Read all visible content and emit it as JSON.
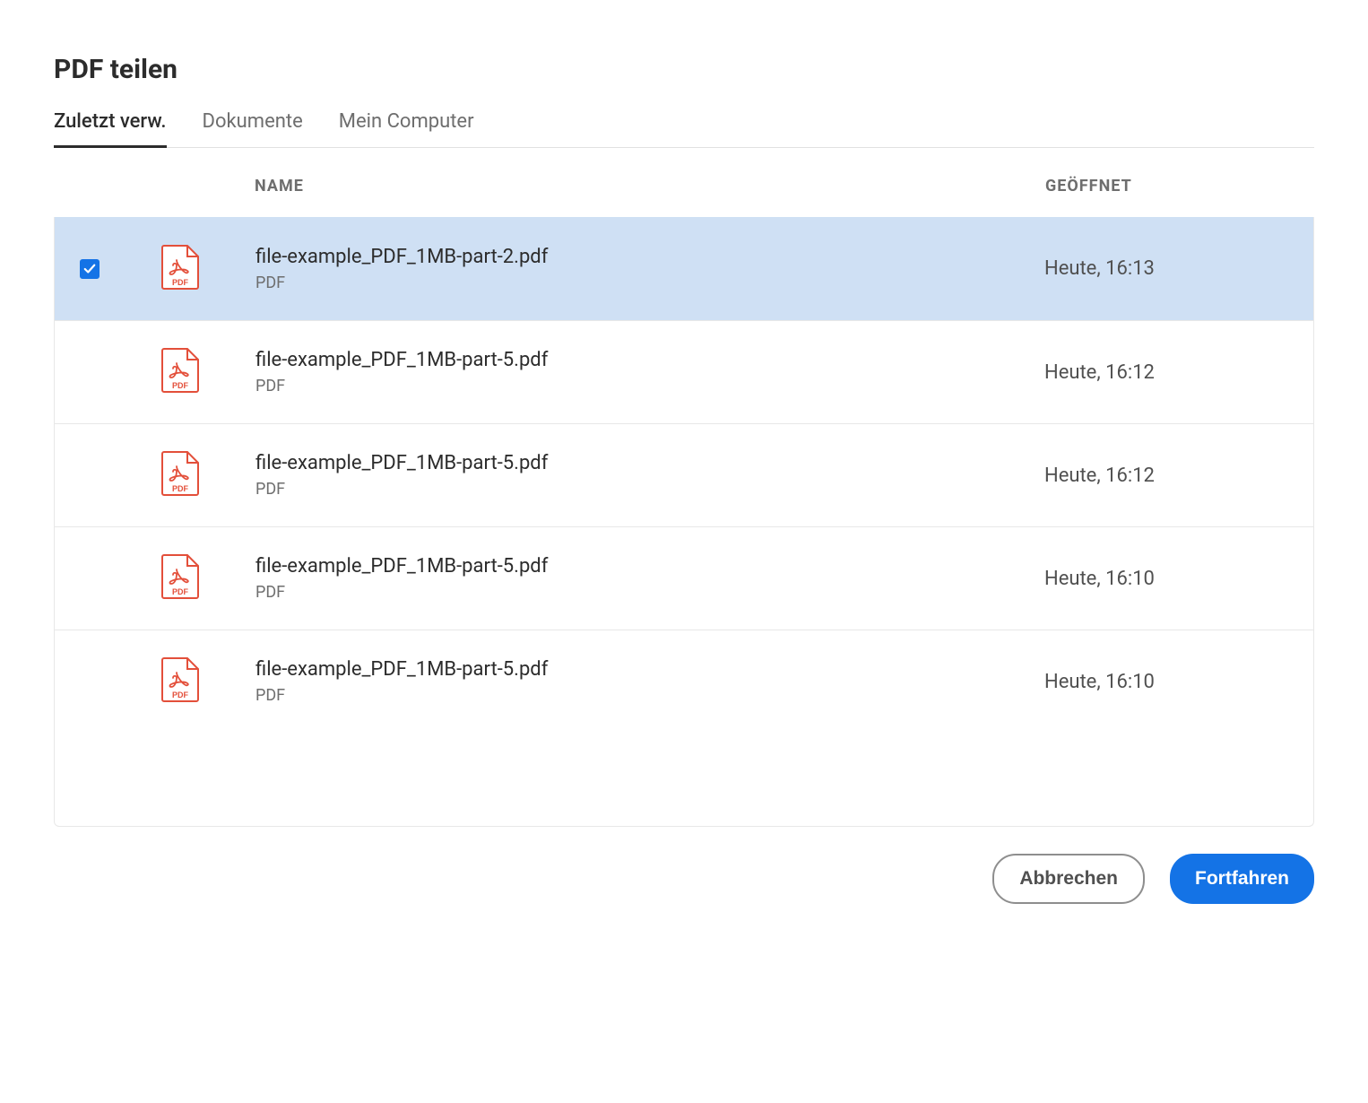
{
  "dialog": {
    "title": "PDF teilen"
  },
  "tabs": [
    {
      "label": "Zuletzt verw.",
      "active": true
    },
    {
      "label": "Dokumente",
      "active": false
    },
    {
      "label": "Mein Computer",
      "active": false
    }
  ],
  "table": {
    "headers": {
      "name": "NAME",
      "opened": "GEÖFFNET"
    },
    "rows": [
      {
        "selected": true,
        "name": "file-example_PDF_1MB-part-2.pdf",
        "type": "PDF",
        "opened": "Heute, 16:13"
      },
      {
        "selected": false,
        "name": "file-example_PDF_1MB-part-5.pdf",
        "type": "PDF",
        "opened": "Heute, 16:12"
      },
      {
        "selected": false,
        "name": "file-example_PDF_1MB-part-5.pdf",
        "type": "PDF",
        "opened": "Heute, 16:12"
      },
      {
        "selected": false,
        "name": "file-example_PDF_1MB-part-5.pdf",
        "type": "PDF",
        "opened": "Heute, 16:10"
      },
      {
        "selected": false,
        "name": "file-example_PDF_1MB-part-5.pdf",
        "type": "PDF",
        "opened": "Heute, 16:10"
      }
    ]
  },
  "footer": {
    "cancel": "Abbrechen",
    "continue": "Fortfahren"
  }
}
